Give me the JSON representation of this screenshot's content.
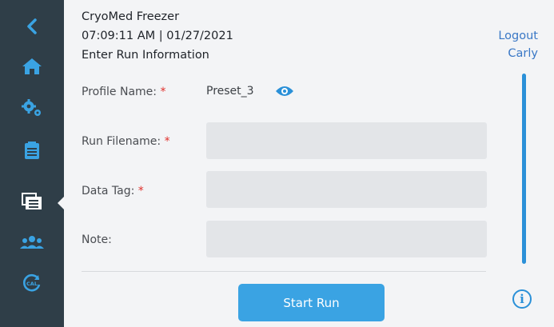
{
  "header": {
    "device": "CryoMed Freezer",
    "datetime": "07:09:11 AM | 01/27/2021",
    "page_title": "Enter Run Information"
  },
  "user": {
    "logout": "Logout",
    "name": "Carly"
  },
  "sidebar": {
    "items": [
      {
        "icon": "back-chevron-icon"
      },
      {
        "icon": "home-icon"
      },
      {
        "icon": "settings-gears-icon"
      },
      {
        "icon": "clipboard-icon"
      },
      {
        "icon": "run-files-icon",
        "active": true
      },
      {
        "icon": "users-icon"
      },
      {
        "icon": "calibration-icon"
      }
    ]
  },
  "form": {
    "required_marker": "*",
    "profile": {
      "label": "Profile Name:",
      "value": "Preset_3"
    },
    "filename": {
      "label": "Run Filename:",
      "value": ""
    },
    "datatag": {
      "label": "Data Tag:",
      "value": ""
    },
    "note": {
      "label": "Note:",
      "value": ""
    }
  },
  "actions": {
    "start": "Start Run",
    "info": "i"
  },
  "colors": {
    "accent": "#2a90d8",
    "button": "#3aa3e3",
    "sidebar": "#2f3e48",
    "required": "#e0302b"
  }
}
